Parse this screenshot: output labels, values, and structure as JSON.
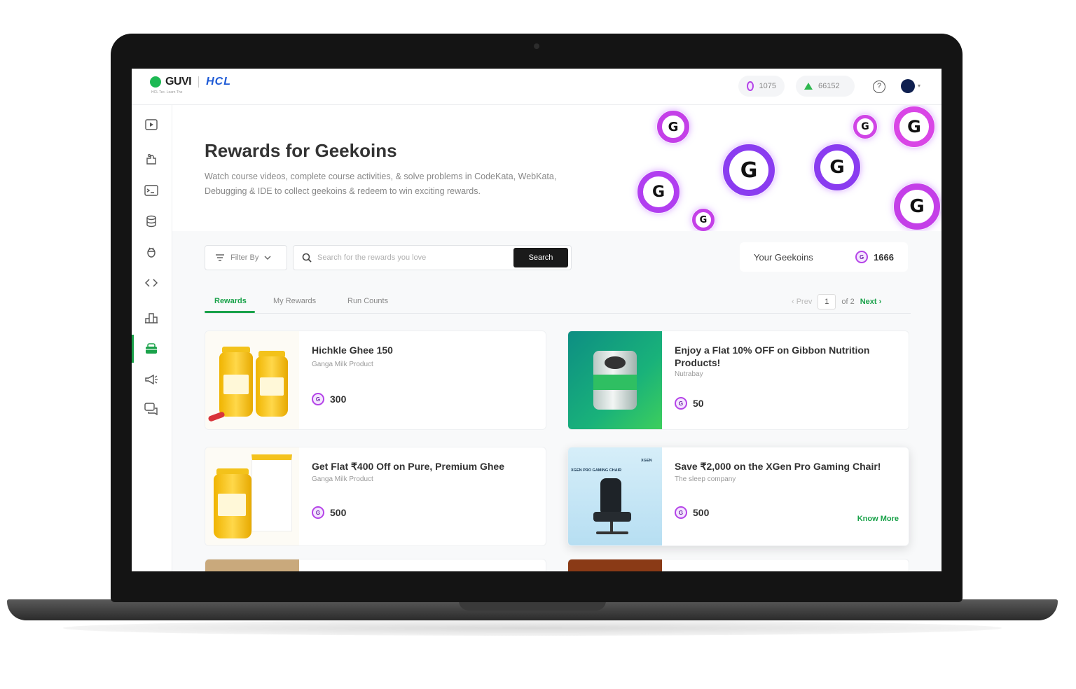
{
  "brand": {
    "name": "GUVI",
    "partner": "HCL",
    "tagline": "HCL Tec. Learn The"
  },
  "topbar": {
    "geekoins_count": "1075",
    "rank_value": "66152",
    "help_label": "?",
    "avatar_caret": "▾"
  },
  "sidebar": {
    "items": [
      {
        "name": "courses",
        "icon": "play-icon"
      },
      {
        "name": "practice",
        "icon": "puzzle-icon"
      },
      {
        "name": "ide",
        "icon": "terminal-icon"
      },
      {
        "name": "database",
        "icon": "database-icon"
      },
      {
        "name": "debugging",
        "icon": "bug-icon"
      },
      {
        "name": "webkata",
        "icon": "code-icon"
      },
      {
        "name": "leaderboard",
        "icon": "leaderboard-icon"
      },
      {
        "name": "rewards",
        "icon": "gift-icon",
        "active": true
      },
      {
        "name": "announcements",
        "icon": "megaphone-icon"
      },
      {
        "name": "forum",
        "icon": "chat-icon"
      }
    ]
  },
  "page": {
    "title": "Rewards for Geekoins",
    "description": "Watch course videos, complete course activities, & solve problems in CodeKata, WebKata, Debugging & IDE to collect geekoins & redeem to win exciting rewards."
  },
  "toolbar": {
    "filter_label": "Filter By",
    "search_placeholder": "Search for the rewards you love",
    "search_button": "Search",
    "your_geekoins_label": "Your Geekoins",
    "your_geekoins_value": "1666"
  },
  "tabs": [
    {
      "label": "Rewards",
      "active": true
    },
    {
      "label": "My Rewards",
      "active": false
    },
    {
      "label": "Run Counts",
      "active": false
    }
  ],
  "pagination": {
    "prev": "‹ Prev",
    "current": "1",
    "of_text": "of 2",
    "next": "Next ›"
  },
  "rewards": [
    {
      "title": "Hichkle Ghee 150",
      "vendor": "Ganga Milk Product",
      "price": "300"
    },
    {
      "title": "Enjoy a Flat 10% OFF on Gibbon Nutrition Products!",
      "vendor": "Nutrabay",
      "price": "50"
    },
    {
      "title": "Get Flat ₹400 Off on Pure, Premium Ghee",
      "vendor": "Ganga Milk Product",
      "price": "500"
    },
    {
      "title": "Save ₹2,000 on the XGen Pro Gaming Chair!",
      "vendor": "The sleep company",
      "price": "500",
      "cta": "Know More",
      "image_caption": "XGEN PRO GAMING CHAIR",
      "image_brand": "XGEN"
    }
  ],
  "coin_glyph": "G",
  "colors": {
    "accent": "#1aa24a",
    "coin": "#b544e8",
    "coin_glow": "#a83eff",
    "dark_button": "#1a1a1a"
  }
}
